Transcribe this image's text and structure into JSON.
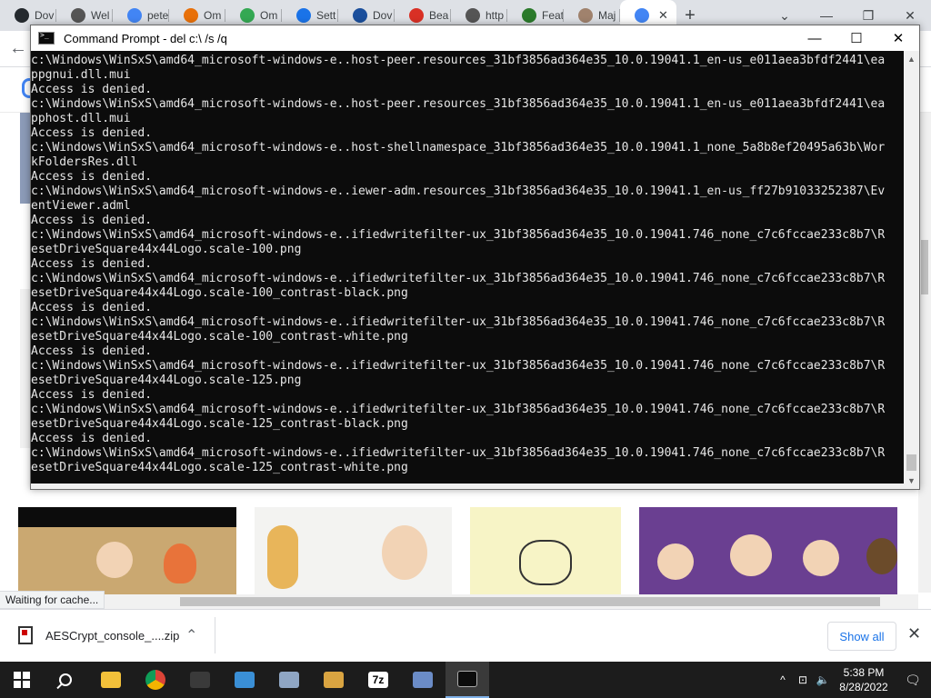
{
  "browser": {
    "tabs": [
      {
        "label": "Dov",
        "icon": "github-icon",
        "color": "#24292e"
      },
      {
        "label": "Wel",
        "icon": "globe-icon",
        "color": "#555555"
      },
      {
        "label": "pete",
        "icon": "google-icon",
        "color": "#4285f4"
      },
      {
        "label": "Om",
        "icon": "folder-icon",
        "color": "#e8710a"
      },
      {
        "label": "Om",
        "icon": "play-store-icon",
        "color": "#34a853"
      },
      {
        "label": "Sett",
        "icon": "gear-icon",
        "color": "#1a73e8"
      },
      {
        "label": "Dov",
        "icon": "q-icon",
        "color": "#1b4f9c"
      },
      {
        "label": "Bea",
        "icon": "lock-icon",
        "color": "#d93025"
      },
      {
        "label": "http",
        "icon": "globe-icon",
        "color": "#555555"
      },
      {
        "label": "Feat",
        "icon": "feature-icon",
        "color": "#2b7a2b"
      },
      {
        "label": "Maj",
        "icon": "avatar-icon",
        "color": "#a0826d"
      },
      {
        "label": "",
        "icon": "google-icon",
        "color": "#4285f4",
        "active": true
      }
    ],
    "tab_close": "✕",
    "new_tab": "+",
    "window_ctrls": {
      "dropdown": "⌄",
      "minimize": "—",
      "restore": "❐",
      "close": "✕"
    },
    "back": "←",
    "status_text": "Waiting for cache..."
  },
  "cmd": {
    "title": "Command Prompt - del  c:\\ /s /q",
    "controls": {
      "minimize": "—",
      "maximize": "☐",
      "close": "✕"
    },
    "lines": [
      "c:\\Windows\\WinSxS\\amd64_microsoft-windows-e..host-peer.resources_31bf3856ad364e35_10.0.19041.1_en-us_e011aea3bfdf2441\\ea",
      "ppgnui.dll.mui",
      "Access is denied.",
      "c:\\Windows\\WinSxS\\amd64_microsoft-windows-e..host-peer.resources_31bf3856ad364e35_10.0.19041.1_en-us_e011aea3bfdf2441\\ea",
      "pphost.dll.mui",
      "Access is denied.",
      "c:\\Windows\\WinSxS\\amd64_microsoft-windows-e..host-shellnamespace_31bf3856ad364e35_10.0.19041.1_none_5a8b8ef20495a63b\\Wor",
      "kFoldersRes.dll",
      "Access is denied.",
      "c:\\Windows\\WinSxS\\amd64_microsoft-windows-e..iewer-adm.resources_31bf3856ad364e35_10.0.19041.1_en-us_ff27b91033252387\\Ev",
      "entViewer.adml",
      "Access is denied.",
      "c:\\Windows\\WinSxS\\amd64_microsoft-windows-e..ifiedwritefilter-ux_31bf3856ad364e35_10.0.19041.746_none_c7c6fccae233c8b7\\R",
      "esetDriveSquare44x44Logo.scale-100.png",
      "Access is denied.",
      "c:\\Windows\\WinSxS\\amd64_microsoft-windows-e..ifiedwritefilter-ux_31bf3856ad364e35_10.0.19041.746_none_c7c6fccae233c8b7\\R",
      "esetDriveSquare44x44Logo.scale-100_contrast-black.png",
      "Access is denied.",
      "c:\\Windows\\WinSxS\\amd64_microsoft-windows-e..ifiedwritefilter-ux_31bf3856ad364e35_10.0.19041.746_none_c7c6fccae233c8b7\\R",
      "esetDriveSquare44x44Logo.scale-100_contrast-white.png",
      "Access is denied.",
      "c:\\Windows\\WinSxS\\amd64_microsoft-windows-e..ifiedwritefilter-ux_31bf3856ad364e35_10.0.19041.746_none_c7c6fccae233c8b7\\R",
      "esetDriveSquare44x44Logo.scale-125.png",
      "Access is denied.",
      "c:\\Windows\\WinSxS\\amd64_microsoft-windows-e..ifiedwritefilter-ux_31bf3856ad364e35_10.0.19041.746_none_c7c6fccae233c8b7\\R",
      "esetDriveSquare44x44Logo.scale-125_contrast-black.png",
      "Access is denied.",
      "c:\\Windows\\WinSxS\\amd64_microsoft-windows-e..ifiedwritefilter-ux_31bf3856ad364e35_10.0.19041.746_none_c7c6fccae233c8b7\\R",
      "esetDriveSquare44x44Logo.scale-125_contrast-white.png"
    ]
  },
  "downloads": {
    "file_name": "AESCrypt_console_....zip",
    "chevron": "⌃",
    "show_all": "Show all",
    "close": "✕"
  },
  "taskbar": {
    "apps": [
      {
        "name": "file-explorer-icon",
        "color": "#f3c13a"
      },
      {
        "name": "chrome-icon",
        "color": "#db4437"
      },
      {
        "name": "obs-icon",
        "color": "#3a3a3a"
      },
      {
        "name": "control-panel-icon",
        "color": "#3a8fd6"
      },
      {
        "name": "network-icon",
        "color": "#8fa6c4"
      },
      {
        "name": "paint-icon",
        "color": "#d9a441"
      },
      {
        "name": "7zip-icon",
        "label": "7z",
        "color": "#ffffff"
      },
      {
        "name": "settings-icon",
        "color": "#6b8cc7"
      },
      {
        "name": "command-prompt-icon",
        "color": "#0c0c0c",
        "active": true
      }
    ],
    "tray": {
      "chevron": "^",
      "network": "⊡",
      "volume": "🔈"
    },
    "time": "5:38 PM",
    "date": "8/28/2022",
    "notifications": "🗨"
  }
}
